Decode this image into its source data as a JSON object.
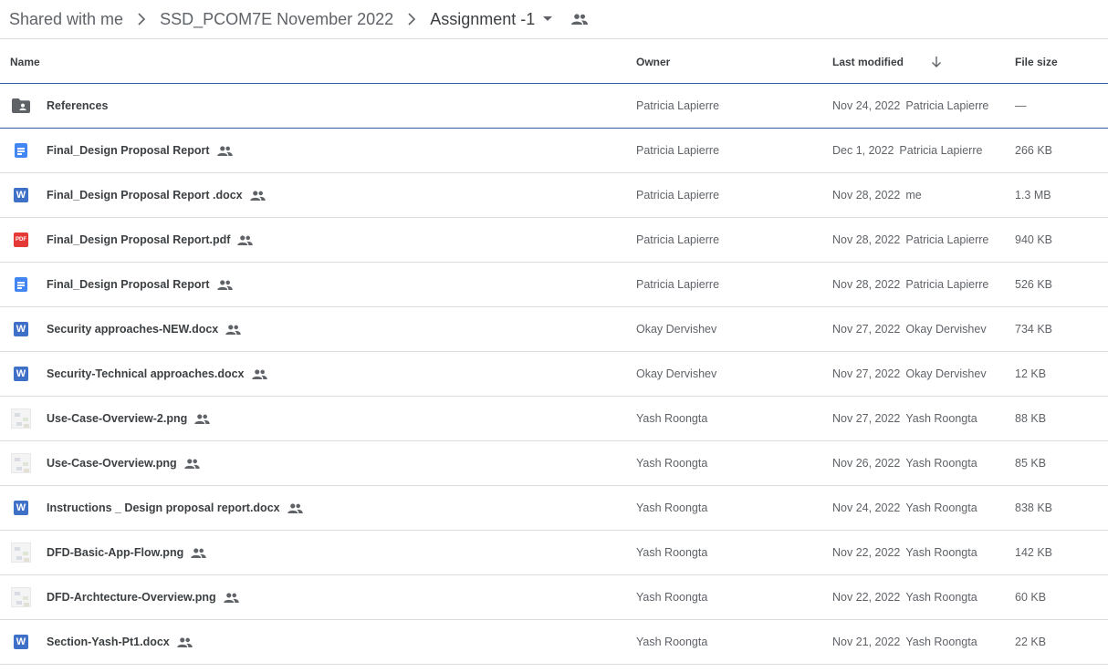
{
  "breadcrumb": {
    "items": [
      "Shared with me",
      "SSD_PCOM7E November 2022",
      "Assignment -1"
    ]
  },
  "columns": {
    "name": "Name",
    "owner": "Owner",
    "last_modified": "Last modified",
    "file_size": "File size"
  },
  "colors": {
    "docs_blue": "#4285f4",
    "word_blue": "#3f70c8",
    "pdf_red": "#e53935",
    "accent_line": "#3c5ba9"
  },
  "files": [
    {
      "icon": "shared-folder-icon",
      "name": "References",
      "shared": false,
      "owner": "Patricia Lapierre",
      "date": "Nov 24, 2022",
      "modified_by": "Patricia Lapierre",
      "size": "—"
    },
    {
      "icon": "google-docs-icon",
      "name": "Final_Design Proposal Report",
      "shared": true,
      "owner": "Patricia Lapierre",
      "date": "Dec 1, 2022",
      "modified_by": "Patricia Lapierre",
      "size": "266 KB"
    },
    {
      "icon": "word-doc-icon",
      "name": "Final_Design Proposal Report .docx",
      "shared": true,
      "owner": "Patricia Lapierre",
      "date": "Nov 28, 2022",
      "modified_by": "me",
      "size": "1.3 MB"
    },
    {
      "icon": "pdf-icon",
      "name": "Final_Design Proposal Report.pdf",
      "shared": true,
      "owner": "Patricia Lapierre",
      "date": "Nov 28, 2022",
      "modified_by": "Patricia Lapierre",
      "size": "940 KB"
    },
    {
      "icon": "google-docs-icon",
      "name": "Final_Design Proposal Report",
      "shared": true,
      "owner": "Patricia Lapierre",
      "date": "Nov 28, 2022",
      "modified_by": "Patricia Lapierre",
      "size": "526 KB"
    },
    {
      "icon": "word-doc-icon",
      "name": "Security approaches-NEW.docx",
      "shared": true,
      "owner": "Okay Dervishev",
      "date": "Nov 27, 2022",
      "modified_by": "Okay Dervishev",
      "size": "734 KB"
    },
    {
      "icon": "word-doc-icon",
      "name": "Security-Technical approaches.docx",
      "shared": true,
      "owner": "Okay Dervishev",
      "date": "Nov 27, 2022",
      "modified_by": "Okay Dervishev",
      "size": "12 KB"
    },
    {
      "icon": "image-thumbnail-icon",
      "name": "Use-Case-Overview-2.png",
      "shared": true,
      "owner": "Yash Roongta",
      "date": "Nov 27, 2022",
      "modified_by": "Yash Roongta",
      "size": "88 KB"
    },
    {
      "icon": "image-thumbnail-icon",
      "name": "Use-Case-Overview.png",
      "shared": true,
      "owner": "Yash Roongta",
      "date": "Nov 26, 2022",
      "modified_by": "Yash Roongta",
      "size": "85 KB"
    },
    {
      "icon": "word-doc-icon",
      "name": "Instructions _ Design proposal report.docx",
      "shared": true,
      "owner": "Yash Roongta",
      "date": "Nov 24, 2022",
      "modified_by": "Yash Roongta",
      "size": "838 KB"
    },
    {
      "icon": "image-thumbnail-icon",
      "name": "DFD-Basic-App-Flow.png",
      "shared": true,
      "owner": "Yash Roongta",
      "date": "Nov 22, 2022",
      "modified_by": "Yash Roongta",
      "size": "142 KB"
    },
    {
      "icon": "image-thumbnail-icon",
      "name": "DFD-Archtecture-Overview.png",
      "shared": true,
      "owner": "Yash Roongta",
      "date": "Nov 22, 2022",
      "modified_by": "Yash Roongta",
      "size": "60 KB"
    },
    {
      "icon": "word-doc-icon",
      "name": "Section-Yash-Pt1.docx",
      "shared": true,
      "owner": "Yash Roongta",
      "date": "Nov 21, 2022",
      "modified_by": "Yash Roongta",
      "size": "22 KB"
    }
  ]
}
